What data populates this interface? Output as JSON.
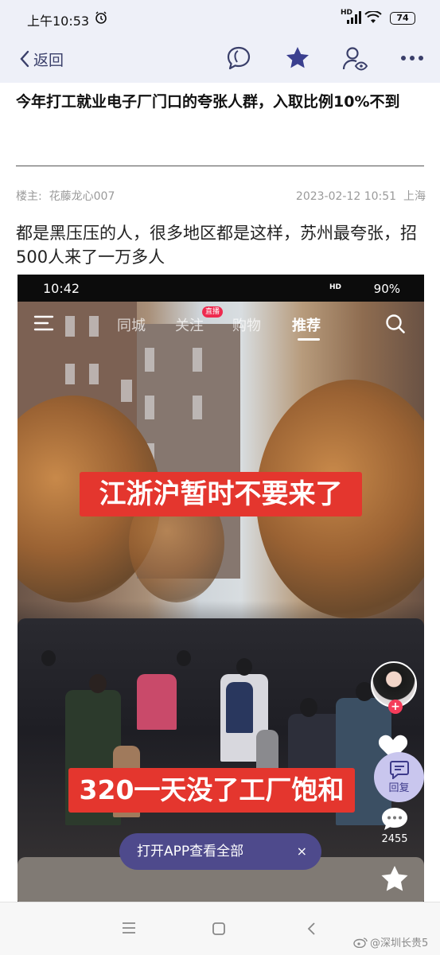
{
  "status_bar": {
    "time": "上午10:53",
    "network": "HD",
    "battery": "74"
  },
  "nav": {
    "back_label": "返回",
    "icons": [
      "comment-bubble-icon",
      "star-icon",
      "user-eye-icon",
      "more-icon"
    ],
    "accent": "#3a3f6a"
  },
  "article": {
    "title": "今年打工就业电子厂门口的夸张人群，入取比例10%不到",
    "author_label": "楼主:",
    "author": "花藤龙心007",
    "datetime": "2023-02-12 10:51",
    "location": "上海",
    "body": "都是黑压压的人，很多地区都是这样，苏州最夸张，招500人来了一万多人"
  },
  "embed": {
    "status_time": "10:42",
    "status_network": "HD",
    "status_battery": "90%",
    "tabs": [
      "同城",
      "关注",
      "购物",
      "推荐"
    ],
    "active_tab": "推荐",
    "live_badge": "直播",
    "caption_top": "江浙沪暂时不要来了",
    "caption_bottom": "320一天没了工厂饱和",
    "open_app": "打开APP查看全部",
    "close": "×",
    "reply_label": "回复",
    "comment_count": "2455",
    "caption_color": "#e4362e",
    "app_button_color": "#4e4a8c"
  },
  "watermark": "@深圳长贵5"
}
